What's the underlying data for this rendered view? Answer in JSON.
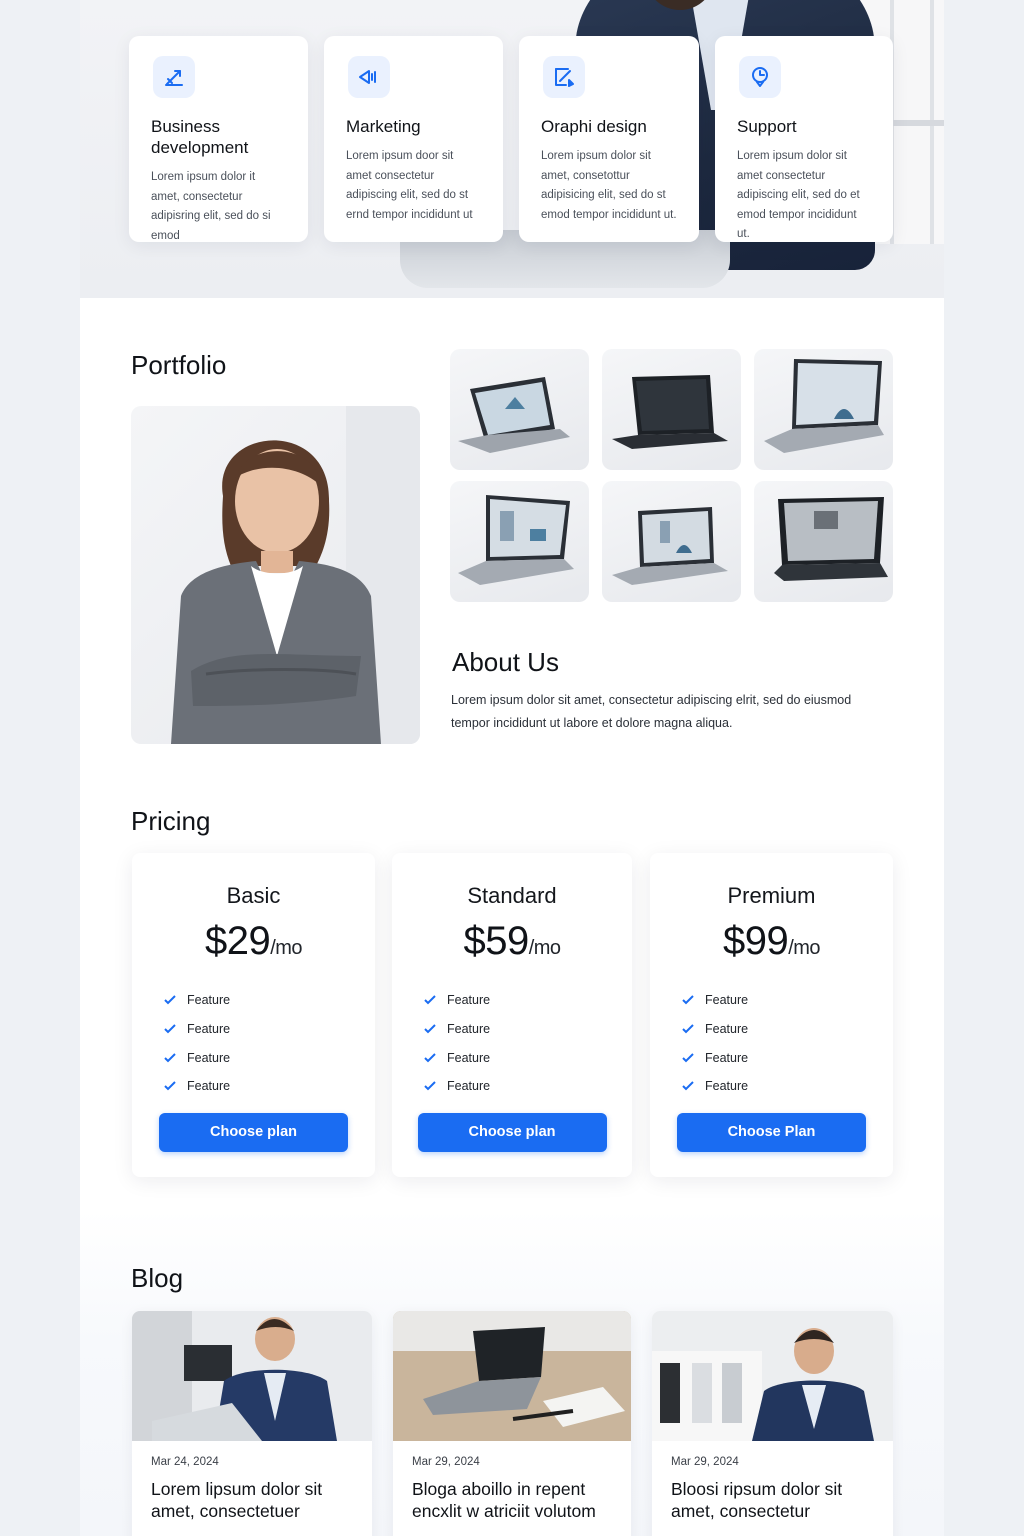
{
  "services": [
    {
      "icon": "chart-growth-icon",
      "title": "Business development",
      "text": "Lorem ipsum dolor it amet, consectetur adipisring elit, sed do si emod"
    },
    {
      "icon": "megaphone-icon",
      "title": "Marketing",
      "text": "Lorem ipsum door sit amet consectetur adipiscing elit, sed do st ernd tempor incididunt ut"
    },
    {
      "icon": "design-pen-icon",
      "title": "Oraphi design",
      "text": "Lorem ipsum dolor sit amet, consetottur adipisicing elit, sed do st emod tempor incididunt ut."
    },
    {
      "icon": "support-pin-icon",
      "title": "Support",
      "text": "Lorem ipsum dolor sit amet consectetur adipiscing elit, sed do et emod tempor incididunt ut."
    }
  ],
  "portfolio": {
    "title": "Portfolio"
  },
  "about": {
    "title": "About Us",
    "text": "Lorem ipsum dolor sit amet, consectetur adipiscing elrit, sed do eiusmod tempor incididunt ut labore et dolore magna aliqua."
  },
  "pricing": {
    "title": "Pricing",
    "plans": [
      {
        "name": "Basic",
        "price": "$29",
        "per": "/mo",
        "features": [
          "Feature",
          "Feature",
          "Feature",
          "Feature"
        ],
        "button": "Choose plan"
      },
      {
        "name": "Standard",
        "price": "$59",
        "per": "/mo",
        "features": [
          "Feature",
          "Feature",
          "Feature",
          "Feature"
        ],
        "button": "Choose plan"
      },
      {
        "name": "Premium",
        "price": "$99",
        "per": "/mo",
        "features": [
          "Feature",
          "Feature",
          "Feature",
          "Feature"
        ],
        "button": "Choose Plan"
      }
    ]
  },
  "blog": {
    "title": "Blog",
    "posts": [
      {
        "date": "Mar 24, 2024",
        "title": "Lorem lipsum dolor sit amet, consectetuer"
      },
      {
        "date": "Mar 29, 2024",
        "title": "Bloga aboillo in repent encxlit w atriciit volutom"
      },
      {
        "date": "Mar 29, 2024",
        "title": "Bloosi ripsum dolor sit amet, consectetur"
      }
    ]
  },
  "colors": {
    "accent": "#1a6cf2",
    "icon_bg": "#eaf1fe",
    "text_dark": "#101318"
  }
}
